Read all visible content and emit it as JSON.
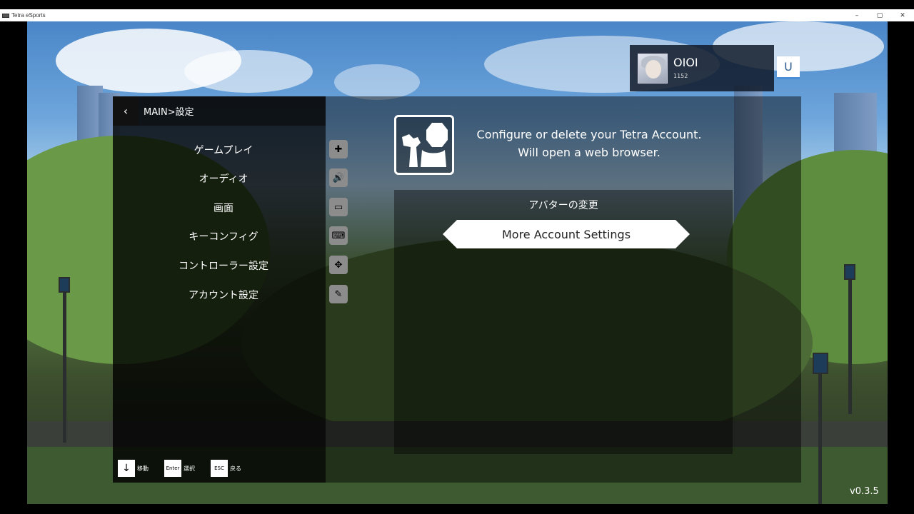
{
  "window": {
    "title": "Tetra eSports",
    "controls": [
      "–",
      "▢",
      "✕"
    ]
  },
  "header": {
    "breadcrumb": "MAIN>設定",
    "back_icon": "chevron-left-icon"
  },
  "sidebar": {
    "items": [
      {
        "label": "ゲームプレイ",
        "icon": "gameplay-icon",
        "glyph": "✚"
      },
      {
        "label": "オーディオ",
        "icon": "speaker-icon",
        "glyph": "🔊"
      },
      {
        "label": "画面",
        "icon": "monitor-icon",
        "glyph": "▭"
      },
      {
        "label": "キーコンフィグ",
        "icon": "keyboard-icon",
        "glyph": "⌨"
      },
      {
        "label": "コントローラー設定",
        "icon": "gamepad-icon",
        "glyph": "✥"
      },
      {
        "label": "アカウント設定",
        "icon": "wrench-account-icon",
        "glyph": "✎"
      }
    ]
  },
  "detail": {
    "description_line1": "Configure or delete your Tetra Account.",
    "description_line2": "Will open a web browser.",
    "options": [
      {
        "label": "アバターの変更",
        "selected": false
      },
      {
        "label": "More Account Settings",
        "selected": true
      }
    ]
  },
  "hints": [
    {
      "key": "↓",
      "label": "移動"
    },
    {
      "key": "Enter",
      "label": "選択"
    },
    {
      "key": "ESC",
      "label": "戻る"
    }
  ],
  "profile": {
    "name": "OIOI",
    "rating": "1152",
    "badge": "U"
  },
  "version": "v0.3.5",
  "colors": {
    "panel_bg": "#000000",
    "highlight": "#ffffff",
    "badge_accent": "#4a90d9"
  }
}
